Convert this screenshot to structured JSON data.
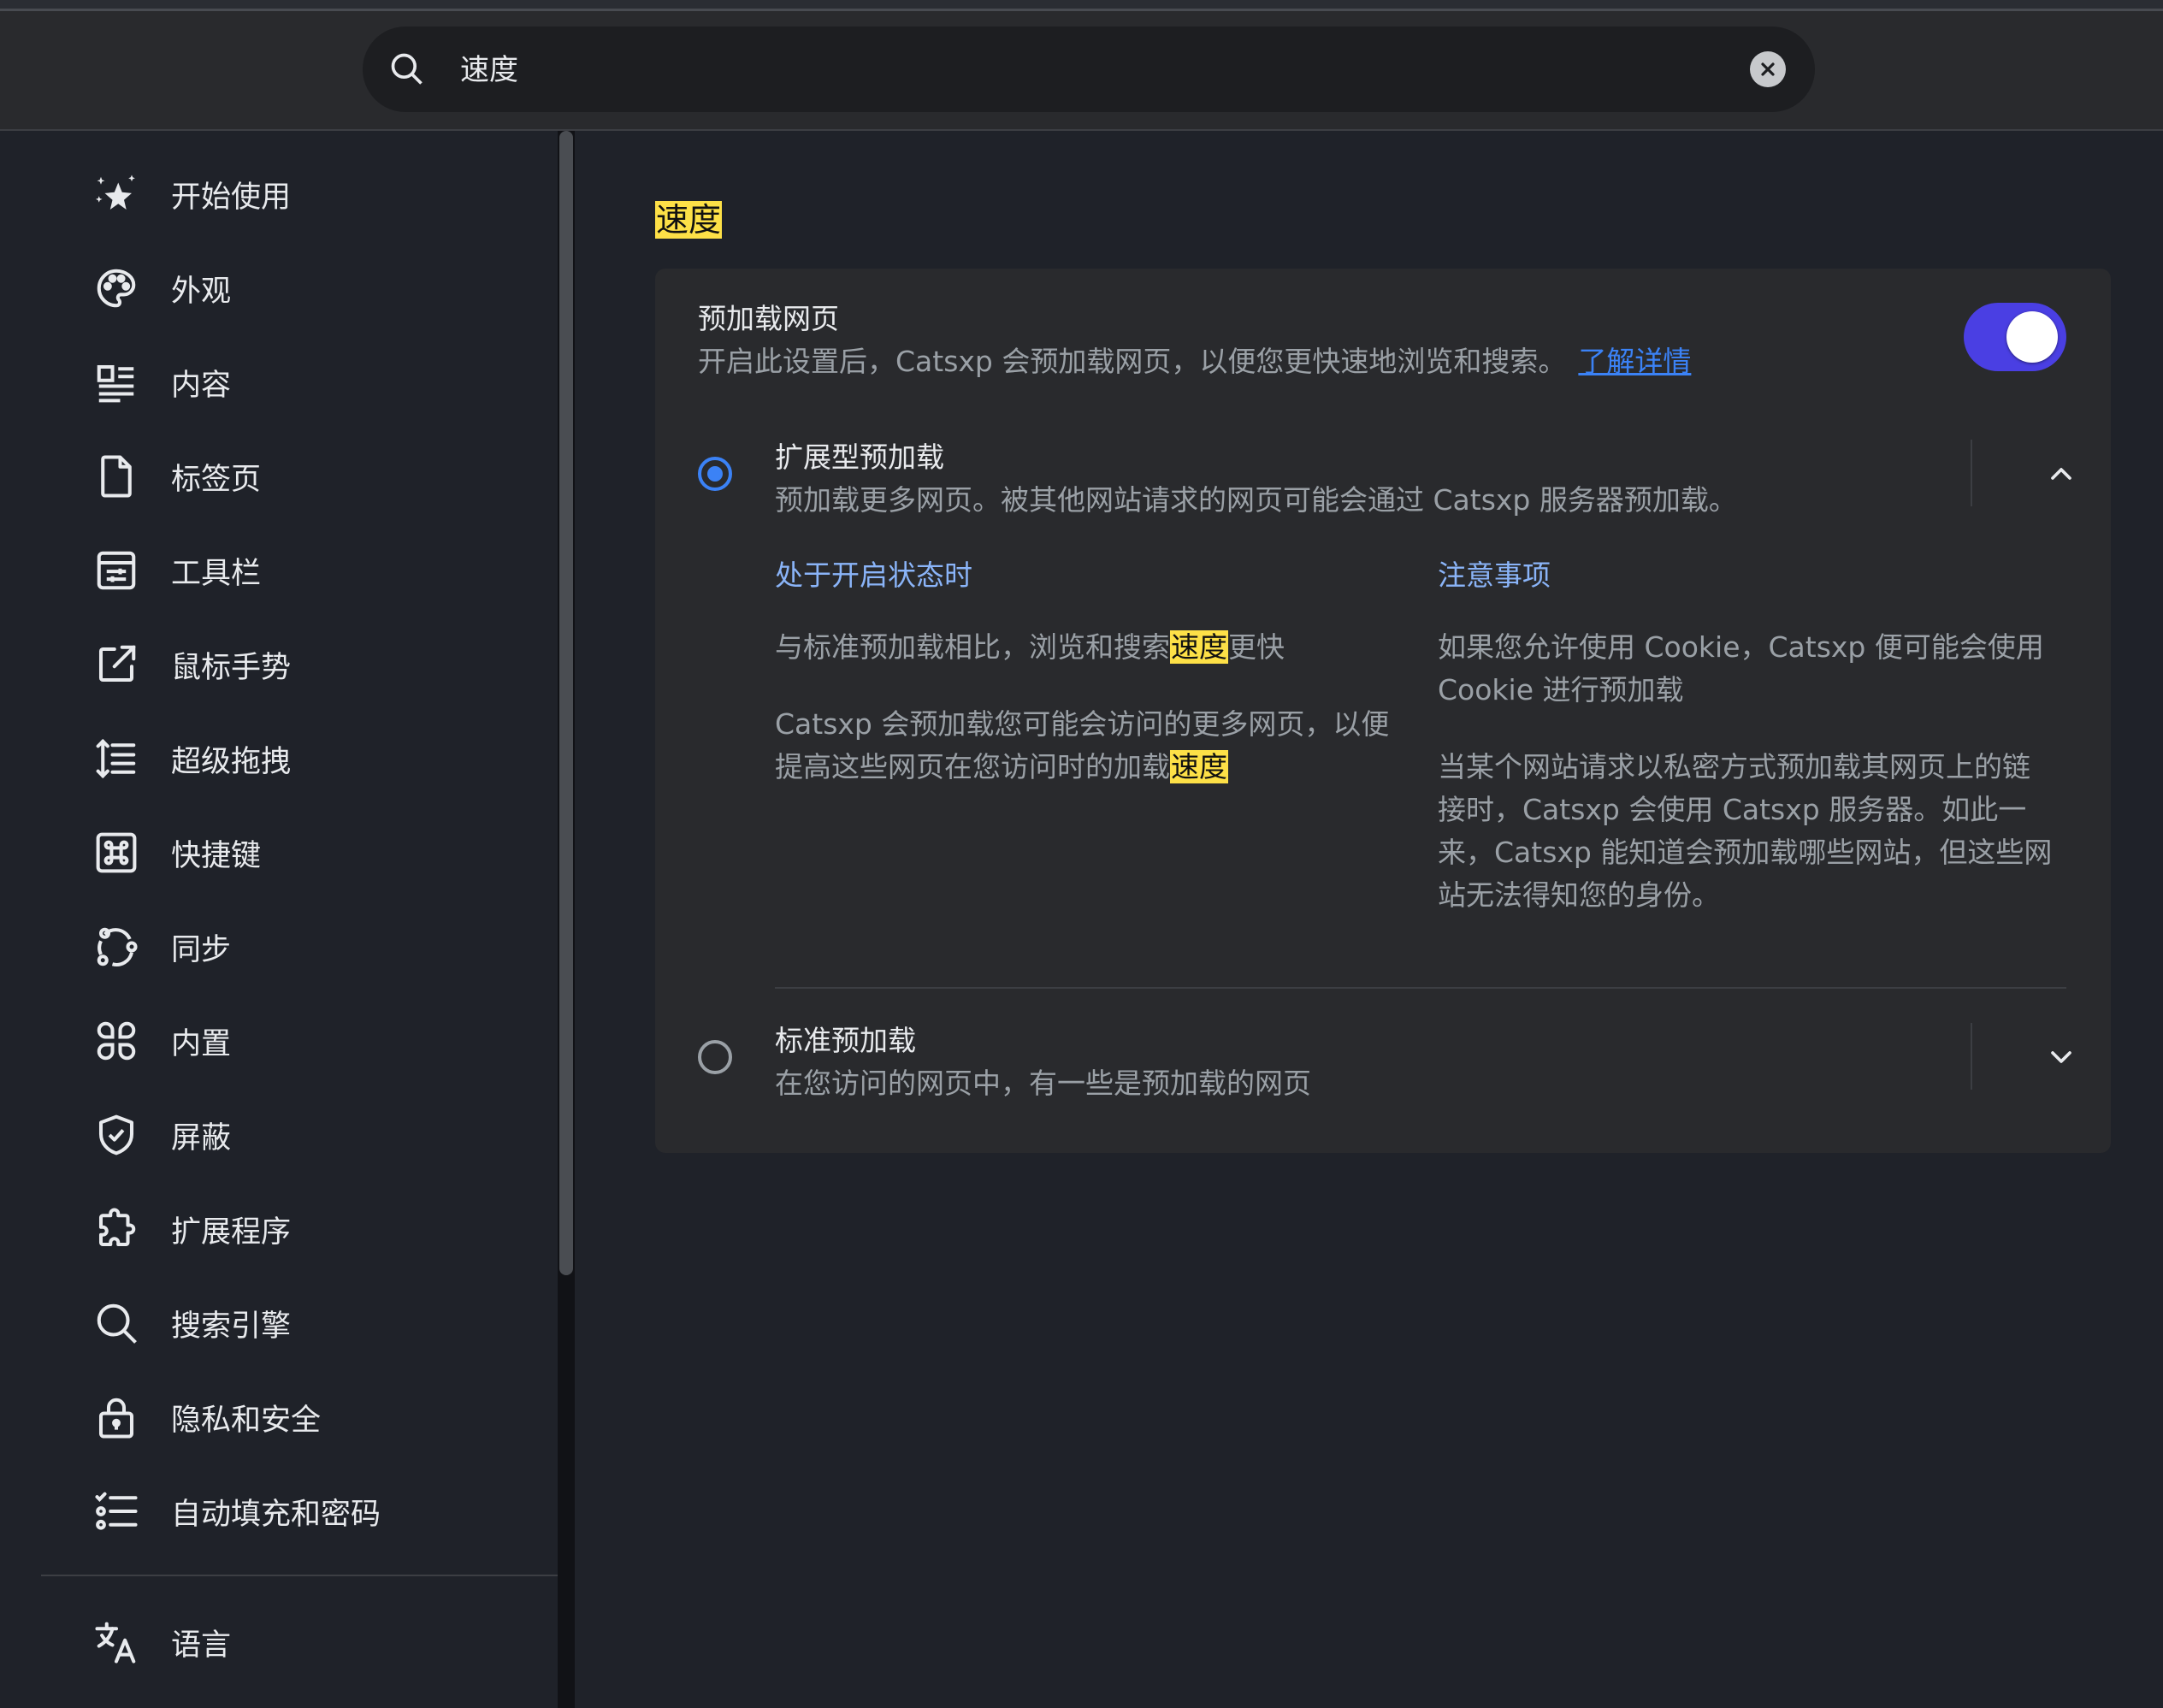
{
  "search": {
    "value": "速度",
    "icon": "search-icon",
    "clear_icon": "close-icon"
  },
  "sidebar": {
    "items": [
      {
        "label": "开始使用",
        "icon": "sparkle-star-icon"
      },
      {
        "label": "外观",
        "icon": "palette-icon"
      },
      {
        "label": "内容",
        "icon": "content-list-icon"
      },
      {
        "label": "标签页",
        "icon": "page-icon"
      },
      {
        "label": "工具栏",
        "icon": "toolbar-icon"
      },
      {
        "label": "鼠标手势",
        "icon": "external-arrow-icon"
      },
      {
        "label": "超级拖拽",
        "icon": "drag-list-icon"
      },
      {
        "label": "快捷键",
        "icon": "command-key-icon"
      },
      {
        "label": "同步",
        "icon": "sync-icon"
      },
      {
        "label": "内置",
        "icon": "apps-icon"
      },
      {
        "label": "屏蔽",
        "icon": "shield-check-icon"
      },
      {
        "label": "扩展程序",
        "icon": "puzzle-icon"
      },
      {
        "label": "搜索引擎",
        "icon": "search-icon"
      },
      {
        "label": "隐私和安全",
        "icon": "lock-icon"
      },
      {
        "label": "自动填充和密码",
        "icon": "checklist-icon"
      }
    ],
    "language": {
      "label": "语言",
      "icon": "translate-icon"
    }
  },
  "main": {
    "section_title": "速度",
    "preload": {
      "title": "预加载网页",
      "description": "开启此设置后，Catsxp 会预加载网页，以便您更快速地浏览和搜索。",
      "learn_more": "了解详情",
      "enabled": true,
      "extended": {
        "title": "扩展型预加载",
        "description": "预加载更多网页。被其他网站请求的网页可能会通过 Catsxp 服务器预加载。",
        "selected": true,
        "when_on": {
          "heading": "处于开启状态时",
          "p1_before": "与标准预加载相比，浏览和搜索",
          "p1_highlight": "速度",
          "p1_after": "更快",
          "p2_before": "Catsxp 会预加载您可能会访问的更多网页，以便提高这些网页在您访问时的加载",
          "p2_highlight": "速度"
        },
        "notes": {
          "heading": "注意事项",
          "p1": "如果您允许使用 Cookie，Catsxp 便可能会使用 Cookie 进行预加载",
          "p2": "当某个网站请求以私密方式预加载其网页上的链接时，Catsxp 会使用 Catsxp 服务器。如此一来，Catsxp 能知道会预加载哪些网站，但这些网站无法得知您的身份。"
        }
      },
      "standard": {
        "title": "标准预加载",
        "description": "在您访问的网页中，有一些是预加载的网页",
        "selected": false
      }
    }
  },
  "colors": {
    "accent": "#3b82f6",
    "toggle_on": "#4a3fe3",
    "highlight": "#fde047",
    "background": "#1f2229",
    "card": "#292a2d"
  }
}
